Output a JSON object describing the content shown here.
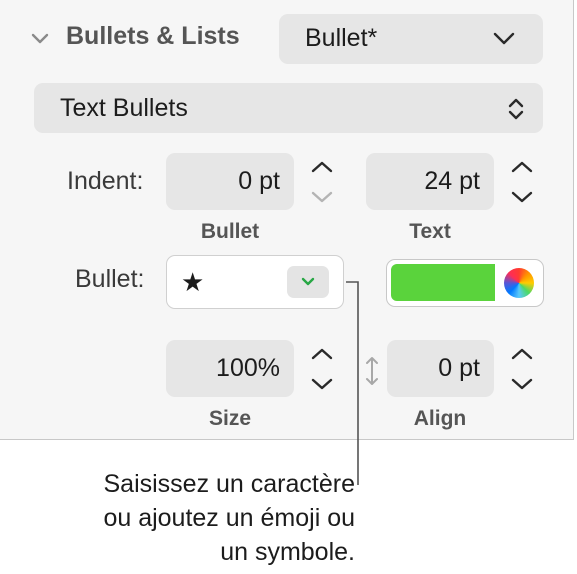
{
  "section": {
    "title": "Bullets & Lists",
    "style_popup_value": "Bullet*",
    "type_popup_value": "Text Bullets"
  },
  "indent": {
    "label": "Indent:",
    "bullet_value": "0 pt",
    "bullet_sublabel": "Bullet",
    "text_value": "24 pt",
    "text_sublabel": "Text"
  },
  "bullet": {
    "label": "Bullet:",
    "character": "★",
    "color": "#5ad33c"
  },
  "size": {
    "value": "100%",
    "sublabel": "Size"
  },
  "align": {
    "value": "0 pt",
    "sublabel": "Align"
  },
  "callout": {
    "line1": "Saisissez un caractère",
    "line2": "ou ajoutez un émoji ou",
    "line3": "un symbole."
  },
  "icons": {
    "section_toggle": "chevron-down-icon",
    "popup": "chevron-down-icon",
    "updown": "updown-chevron-icon",
    "stepper": "stepper-arrows-icon",
    "align_indicator": "vertical-resize-icon",
    "color_picker": "color-wheel-icon"
  }
}
